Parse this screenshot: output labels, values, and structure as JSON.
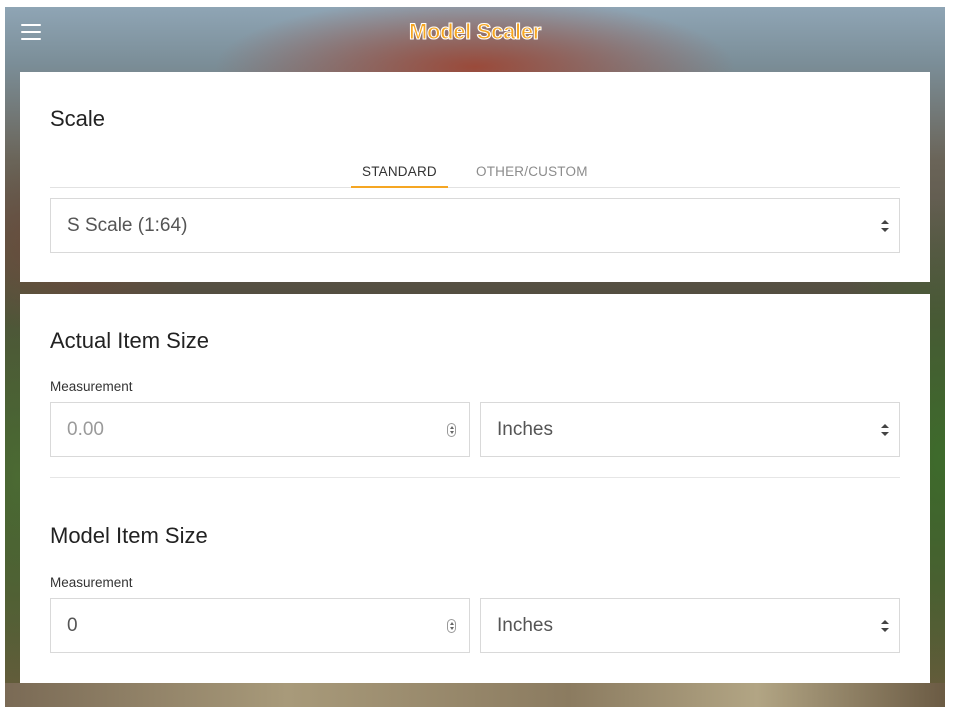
{
  "app": {
    "title": "Model Scaler"
  },
  "scale_section": {
    "title": "Scale",
    "tabs": [
      {
        "label": "STANDARD",
        "active": true
      },
      {
        "label": "OTHER/CUSTOM",
        "active": false
      }
    ],
    "selected_scale": "S Scale (1:64)"
  },
  "actual_section": {
    "title": "Actual Item Size",
    "measurement_label": "Measurement",
    "measurement_placeholder": "0.00",
    "unit": "Inches"
  },
  "model_section": {
    "title": "Model Item Size",
    "measurement_label": "Measurement",
    "measurement_value": "0",
    "unit": "Inches"
  },
  "colors": {
    "accent": "#f5a623",
    "border": "#d9d9d9"
  },
  "icons": {
    "menu": "hamburger-menu-icon",
    "select": "select-arrows-icon",
    "number": "number-spinner-icon"
  }
}
